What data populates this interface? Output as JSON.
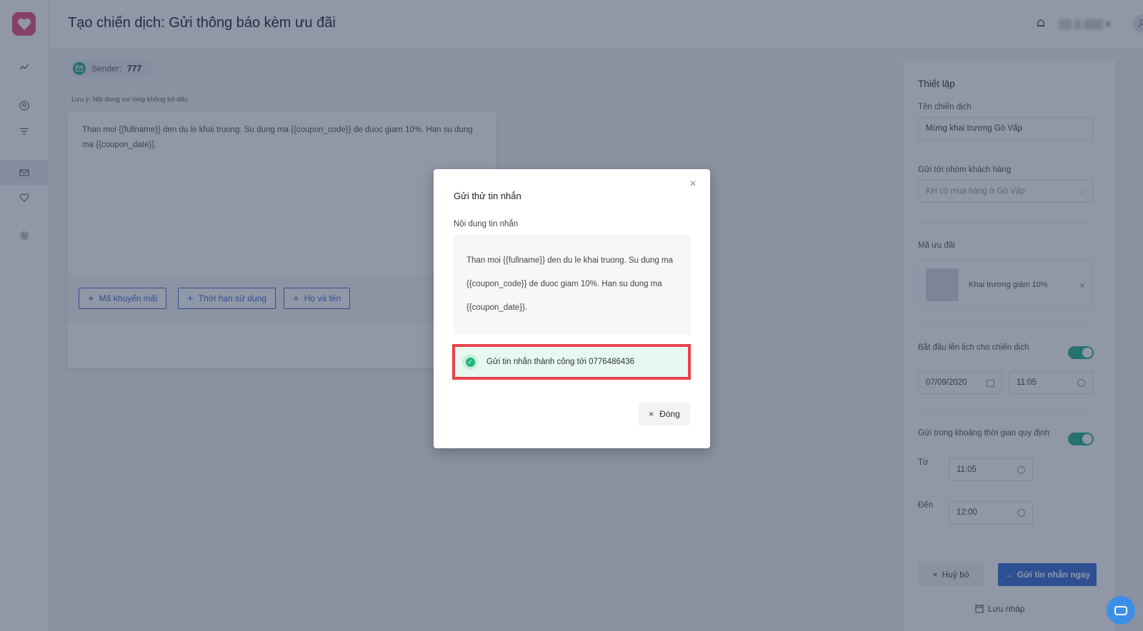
{
  "header": {
    "title": "Tạo chiến dịch: Gửi thông báo kèm ưu đãi",
    "user_name": "▒▒ ▒ ▒▒▒ ▾"
  },
  "sender": {
    "label": "Sender:",
    "value": "777"
  },
  "note": "Lưu ý: Nội dung vui lòng không bỏ dấu",
  "editor": {
    "content": "Than moi {{fullname}} den du le khai truong. Su dung ma {{coupon_code}} de duoc giam 10%. Han su dung ma {{coupon_date}}.",
    "buttons": [
      "Mã khuyến mãi",
      "Thời hạn sử dụng",
      "Họ và tên"
    ]
  },
  "panel": {
    "title": "Thiết lập",
    "campaign_name_label": "Tên chiến dịch",
    "campaign_name_value": "Mừng khai trương Gò  Vấp",
    "group_label": "Gửi tới nhóm khách hàng",
    "group_value": "KH có mua hàng ở Gò Vấp",
    "coupon_label": "Mã ưu đãi",
    "coupon_name": "Khai trương giảm 10%",
    "schedule_label": "Bắt đầu lên lịch cho chiến dịch",
    "schedule_date": "07/09/2020",
    "schedule_time": "11:05",
    "window_label": "Gửi trong khoảng thời gian quy định",
    "from_label": "Từ",
    "from_value": "11:05",
    "to_label": "Đến",
    "to_value": "12:00",
    "cancel_label": "Huỷ bỏ",
    "send_label": "Gửi tin nhắn ngay",
    "draft_label": "Lưu nháp"
  },
  "modal": {
    "title": "Gửi thử tin nhắn",
    "content_label": "Nội dung tin nhắn",
    "message": "Than moi {{fullname}} den du le khai truong. Su dung ma {{coupon_code}} de duoc giam 10%. Han su dung ma {{coupon_date}}.",
    "success": "Gửi tin nhắn thành công tới 0776486436",
    "close_label": "Đóng"
  }
}
